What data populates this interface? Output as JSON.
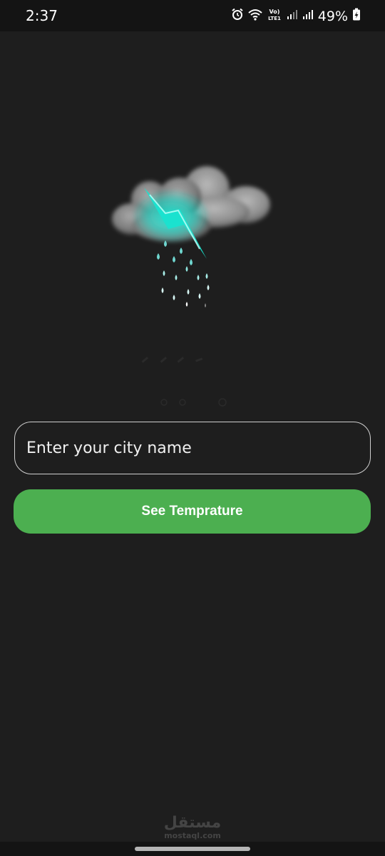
{
  "status_bar": {
    "time": "2:37",
    "volte_label": "Vo)\nLTE1",
    "battery_percent": "49%",
    "icons": [
      "alarm-icon",
      "wifi-icon",
      "volte-icon",
      "signal-icon",
      "signal-icon",
      "battery-charging-icon"
    ]
  },
  "weather_illustration": {
    "icon": "thunderstorm-cloud-icon",
    "accent_color": "#19e3d0"
  },
  "form": {
    "city_placeholder": "Enter your city name",
    "city_value": "",
    "submit_label": "See Temprature",
    "button_color": "#4caf50"
  },
  "watermark": {
    "arabic_text": "مستقل",
    "latin_text": "mostaql.com"
  }
}
